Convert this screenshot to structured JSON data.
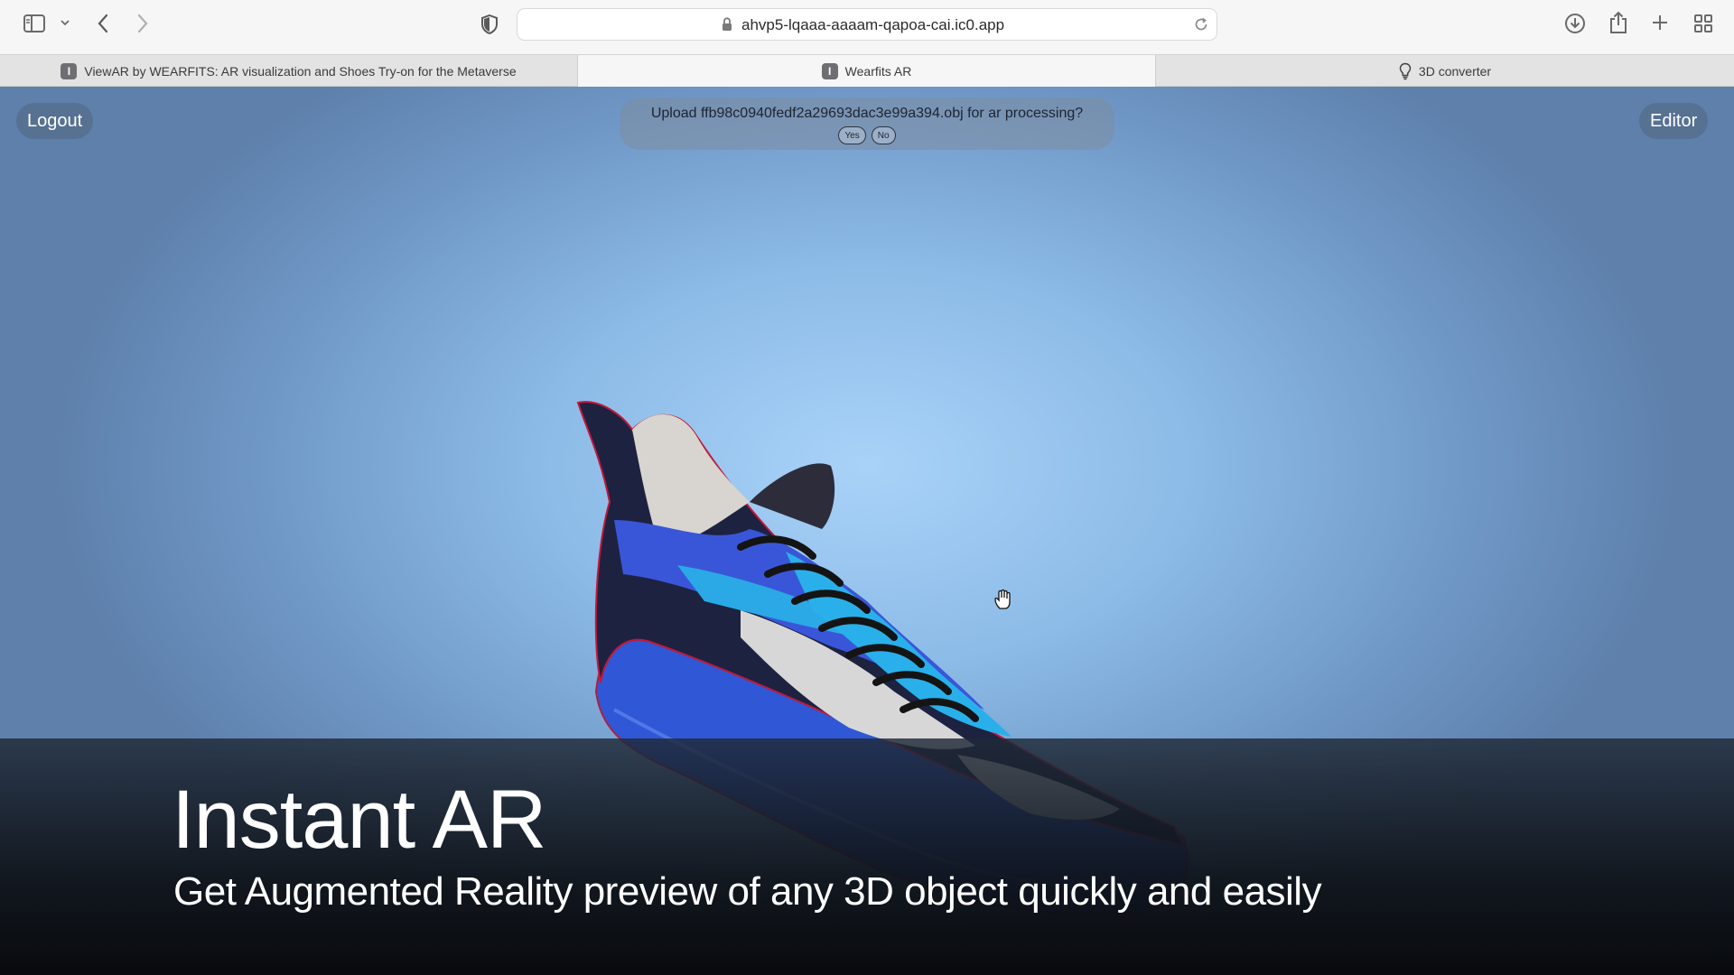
{
  "browser": {
    "url": "ahvp5-lqaaa-aaaam-qapoa-cai.ic0.app",
    "tabs": [
      {
        "title": "ViewAR by WEARFITS: AR visualization and Shoes Try-on for the Metaverse",
        "favicon": "I"
      },
      {
        "title": "Wearfits AR",
        "favicon": "I"
      },
      {
        "title": "3D converter",
        "favicon": "lightbulb-icon"
      }
    ],
    "active_tab": 1,
    "icons": [
      "sidebar-icon",
      "chevron-down-icon",
      "back-icon",
      "forward-icon",
      "shield-icon",
      "lock-icon",
      "reload-icon",
      "download-icon",
      "share-icon",
      "plus-icon",
      "tab-grid-icon"
    ]
  },
  "page": {
    "logout_label": "Logout",
    "editor_label": "Editor",
    "prompt": {
      "message": "Upload ffb98c0940fedf2a29693dac3e99a394.obj for ar processing?",
      "yes_label": "Yes",
      "no_label": "No"
    },
    "headline": "Instant AR",
    "subheadline": "Get Augmented Reality preview of any 3D object quickly and easily",
    "model": "sneaker-3d-model",
    "colors": {
      "background_center": "#a9d2f8",
      "background_edge": "#5e80ab",
      "shoe_blue": "#2f57d6",
      "shoe_light_blue": "#2fb3e8"
    }
  }
}
